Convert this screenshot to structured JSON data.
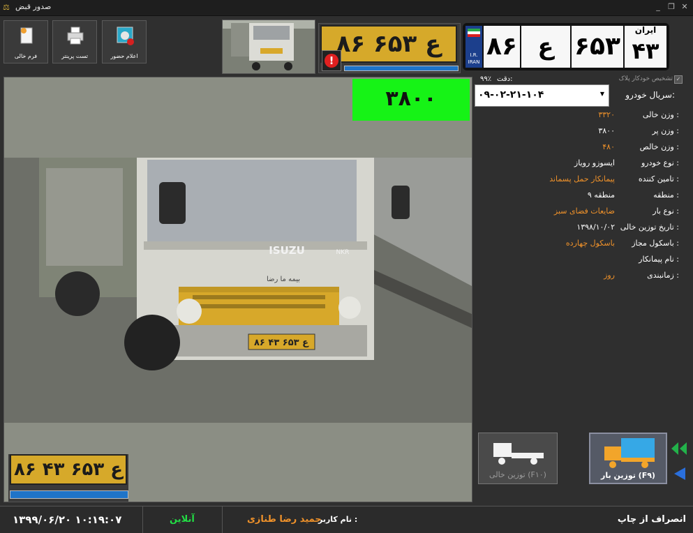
{
  "window": {
    "title": "صدور قبض",
    "icon": "scale-icon"
  },
  "toolbar": {
    "blank_form_label": "فرم خالی",
    "printer_test_label": "تست پرینتر",
    "attendance_label": "اعلام حضور"
  },
  "plate": {
    "country": "ایران",
    "region": "۴۳",
    "serial": "۶۵۳",
    "letter": "ع",
    "number": "۸۶",
    "ir_text": "I.R.",
    "iran_text": "IRAN",
    "crop_text": "۸۶ ع ۶۵۳ ۴۳",
    "alert_icon": "exclamation-icon"
  },
  "recognition": {
    "auto_detect_label": "تشخیص خودکار پلاک",
    "auto_detect_checked": true,
    "accuracy_label": "دقت:",
    "accuracy_value": "۹۹٪"
  },
  "vehicle": {
    "serial_label": "سریال خودرو:",
    "serial_value": "۰۹-۰۲-۲۱-۱۰۴"
  },
  "details": [
    {
      "label": "وزن خالی :",
      "value": "۳۳۲۰",
      "color": "#f0922a"
    },
    {
      "label": "وزن پر :",
      "value": "۳۸۰۰",
      "color": "#ffffff"
    },
    {
      "label": "وزن خالص :",
      "value": "۴۸۰",
      "color": "#f0922a"
    },
    {
      "label": "نوع خودرو :",
      "value": "ایسوزو رویاز",
      "color": "#ffffff"
    },
    {
      "label": "تامین کننده :",
      "value": "پیمانکار حمل پسماند",
      "color": "#f0922a"
    },
    {
      "label": "منطقه :",
      "value": "منطقه ۹",
      "color": "#ffffff"
    },
    {
      "label": "نوع بار :",
      "value": "ضایعات فضای سبز",
      "color": "#f0922a"
    },
    {
      "label": "تاریخ توزین خالی :",
      "value": "۱۳۹۸/۱۰/۰۲",
      "color": "#ffffff"
    },
    {
      "label": "باسکول مجاز :",
      "value": "باسکول چهارده",
      "color": "#f0922a"
    },
    {
      "label": "نام پیمانکار :",
      "value": "",
      "color": "#ffffff"
    },
    {
      "label": "زمانبندی :",
      "value": "روز",
      "color": "#f0922a"
    }
  ],
  "weight_display": "۳۸۰۰",
  "camera": {
    "truck_brand": "ISUZU",
    "truck_model": "NKR",
    "door_text": "بیمه ما رضا",
    "plate_text": "۸۶ ع ۶۵۳ ۴۳"
  },
  "buttons": {
    "weigh_empty": "توزین خالی (F۱۰)",
    "weigh_loaded": "توزین بار (F۹)"
  },
  "status": {
    "cancel_print": "انصراف از چاپ",
    "user_label": "نام کاربر :",
    "user_name": "حمید رضا طنازی",
    "online": "آنلاین",
    "datetime": "۱۳۹۹/۰۶/۲۰   ۱۰:۱۹:۰۷"
  },
  "colors": {
    "accent_orange": "#f0922a",
    "weight_green": "#16f316",
    "online_green": "#22dd44",
    "plate_yellow": "#d6a92a"
  }
}
